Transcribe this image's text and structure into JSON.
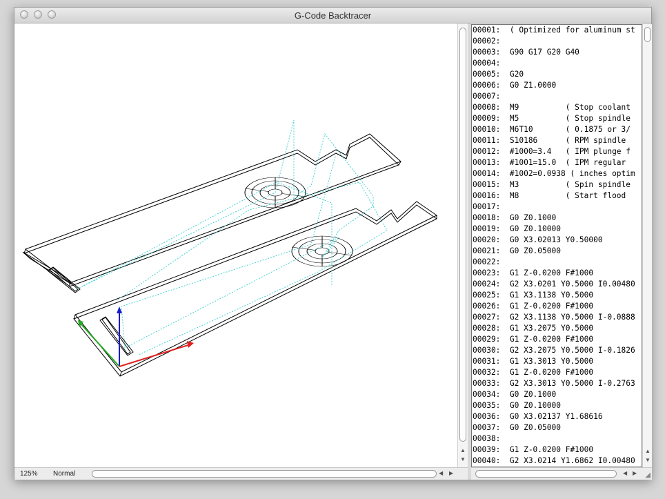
{
  "window": {
    "title": "G-Code Backtracer",
    "buttons": [
      "close",
      "minimize",
      "zoom"
    ]
  },
  "status_bar": {
    "zoom": "125%",
    "mode": "Normal"
  },
  "viewport": {
    "colors": {
      "geometry": "#000000",
      "rapid_moves": "#33cccc",
      "x_axis": "#e02020",
      "y_axis": "#22aa22",
      "z_axis": "#1a1acc"
    }
  },
  "gcode_lines": [
    "00001:  ( Optimized for aluminum st",
    "00002:",
    "00003:  G90 G17 G20 G40",
    "00004:",
    "00005:  G20",
    "00006:  G0 Z1.0000",
    "00007:",
    "00008:  M9          ( Stop coolant",
    "00009:  M5          ( Stop spindle",
    "00010:  M6T10       ( 0.1875 or 3/",
    "00011:  S10186      ( RPM spindle",
    "00012:  #1000=3.4   ( IPM plunge f",
    "00013:  #1001=15.0  ( IPM regular",
    "00014:  #1002=0.0938 ( inches optim",
    "00015:  M3          ( Spin spindle",
    "00016:  M8          ( Start flood",
    "00017:",
    "00018:  G0 Z0.1000",
    "00019:  G0 Z0.10000",
    "00020:  G0 X3.02013 Y0.50000",
    "00021:  G0 Z0.05000",
    "00022:",
    "00023:  G1 Z-0.0200 F#1000",
    "00024:  G2 X3.0201 Y0.5000 I0.00480",
    "00025:  G1 X3.1138 Y0.5000",
    "00026:  G1 Z-0.0200 F#1000",
    "00027:  G2 X3.1138 Y0.5000 I-0.0888",
    "00028:  G1 X3.2075 Y0.5000",
    "00029:  G1 Z-0.0200 F#1000",
    "00030:  G2 X3.2075 Y0.5000 I-0.1826",
    "00031:  G1 X3.3013 Y0.5000",
    "00032:  G1 Z-0.0200 F#1000",
    "00033:  G2 X3.3013 Y0.5000 I-0.2763",
    "00034:  G0 Z0.1000",
    "00035:  G0 Z0.10000",
    "00036:  G0 X3.02137 Y1.68616",
    "00037:  G0 Z0.05000",
    "00038:",
    "00039:  G1 Z-0.0200 F#1000",
    "00040:  G2 X3.0214 Y1.6862 I0.00480"
  ]
}
